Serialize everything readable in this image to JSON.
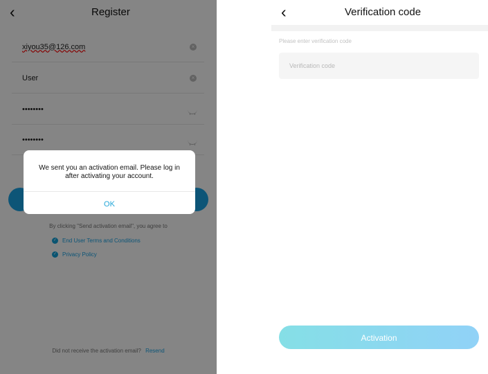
{
  "left_screen": {
    "title": "Register",
    "back_icon": "‹",
    "fields": [
      {
        "value": "xiyou35@126.com",
        "icon": "clear-icon"
      },
      {
        "value": "User",
        "icon": "clear-icon"
      },
      {
        "value": "••••••••",
        "icon": "eye-off-icon"
      },
      {
        "value": "••••••••",
        "icon": "eye-off-icon"
      }
    ],
    "agreement_prefix": "By clicking \"Send activation email\", you agree to",
    "agreements": [
      "End User Terms and Conditions",
      "Privacy Policy"
    ],
    "resend_prompt": "Did not receive the activation email?",
    "resend_link": "Resend",
    "dialog": {
      "message": "We sent you an activation email. Please log in after activating your account.",
      "button": "OK"
    }
  },
  "right_screen": {
    "title": "Verification code",
    "back_icon": "‹",
    "hint": "Please enter verification code",
    "input_placeholder": "Verification code",
    "button": "Activation"
  },
  "colors": {
    "accent": "#22a6d8",
    "overlay": "#000000",
    "gradient_start": "#85dfe6",
    "gradient_end": "#91d2f7"
  }
}
